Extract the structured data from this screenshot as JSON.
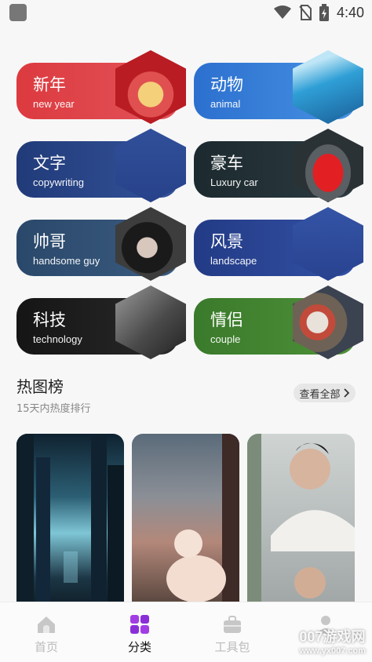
{
  "status_bar": {
    "time": "4:40"
  },
  "categories": [
    {
      "zh": "新年",
      "en": "new year"
    },
    {
      "zh": "动物",
      "en": "animal"
    },
    {
      "zh": "文字",
      "en": "copywriting"
    },
    {
      "zh": "豪车",
      "en": "Luxury car"
    },
    {
      "zh": "帅哥",
      "en": "handsome guy"
    },
    {
      "zh": "风景",
      "en": "landscape"
    },
    {
      "zh": "科技",
      "en": "technology"
    },
    {
      "zh": "情侣",
      "en": "couple"
    }
  ],
  "hot": {
    "title": "热图榜",
    "subtitle": "15天内热度排行",
    "see_all": "查看全部"
  },
  "nav": [
    {
      "label": "首页"
    },
    {
      "label": "分类"
    },
    {
      "label": "工具包"
    },
    {
      "label": ""
    }
  ],
  "watermark": {
    "brand": "007游戏网",
    "url": "www.yx007.com"
  },
  "colors": {
    "new_year": "#d9353a",
    "animal": "#2f7cd6",
    "copywriting": "#24407f",
    "luxury_car": "#1e2a2f",
    "handsome_guy": "#2d4d6f",
    "landscape": "#253d88",
    "technology": "#1b1b1b",
    "couple": "#3d7e2e",
    "nav_active": "#8f3de0"
  }
}
